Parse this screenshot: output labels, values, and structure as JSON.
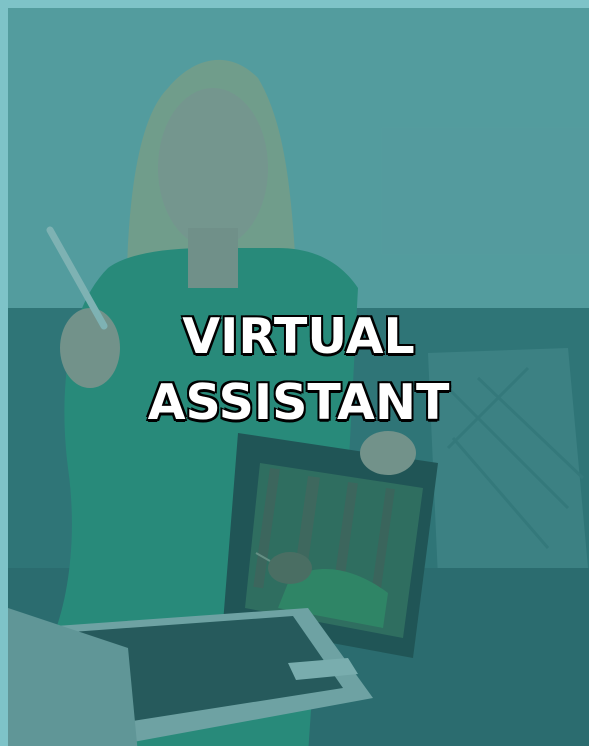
{
  "headline": {
    "line1": "VIRTUAL",
    "line2": "ASSISTANT"
  },
  "colors": {
    "frame": "#7ec3c8",
    "overlay": "#237d80",
    "headline_text": "#ffffff",
    "headline_outline": "#000000"
  }
}
